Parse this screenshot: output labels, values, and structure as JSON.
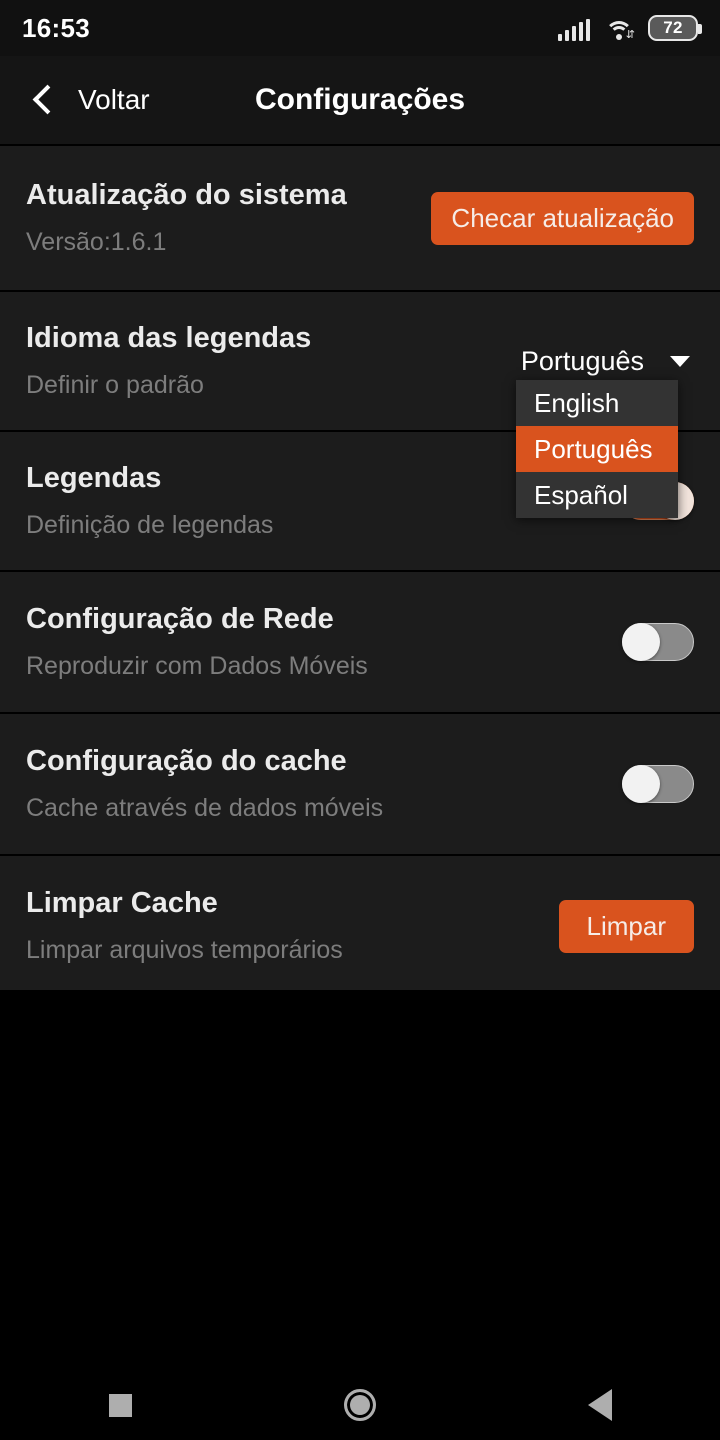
{
  "status_bar": {
    "time": "16:53",
    "battery_level": "72",
    "signal_icon": "cellular-signal-icon",
    "wifi_icon": "wifi-icon"
  },
  "app_bar": {
    "back_label": "Voltar",
    "title": "Configurações"
  },
  "colors": {
    "accent_orange": "#d9531e",
    "row_background": "#1c1c1c",
    "page_background": "#000000",
    "dropdown_background": "#333333",
    "title_text": "#ebebeb",
    "subtitle_text": "#7d7d7d"
  },
  "settings": [
    {
      "title": "Atualização do sistema",
      "subtitle": "Versão:1.6.1",
      "control": "button",
      "button_label": "Checar atualização"
    },
    {
      "title": "Idioma das legendas",
      "subtitle": "Definir o padrão",
      "control": "select",
      "selected_value": "Português"
    },
    {
      "title": "Legendas",
      "subtitle": "Definição de legendas",
      "control": "toggle",
      "toggle_state": "on"
    },
    {
      "title": "Configuração de Rede",
      "subtitle": "Reproduzir com Dados Móveis",
      "control": "toggle",
      "toggle_state": "off"
    },
    {
      "title": "Configuração do cache",
      "subtitle": "Cache através de dados móveis",
      "control": "toggle",
      "toggle_state": "off"
    },
    {
      "title": "Limpar Cache",
      "subtitle": "Limpar arquivos temporários",
      "control": "button",
      "button_label": "Limpar"
    }
  ],
  "language_dropdown": {
    "open": true,
    "options": [
      {
        "label": "English",
        "selected": false
      },
      {
        "label": "Português",
        "selected": true
      },
      {
        "label": "Español",
        "selected": false
      }
    ]
  },
  "nav_bar": {
    "recents": "square-recents-icon",
    "home": "circle-home-icon",
    "back": "triangle-back-icon"
  }
}
